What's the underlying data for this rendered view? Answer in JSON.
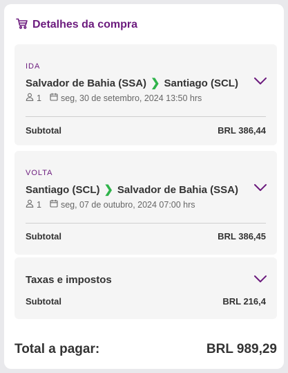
{
  "header": {
    "title": "Detalhes da compra",
    "icon": "shopping-cart-icon"
  },
  "colors": {
    "accent": "#6b1a7d",
    "arrow": "#2fb34a",
    "card_bg": "#f5f5f5"
  },
  "legs": [
    {
      "label": "IDA",
      "origin": "Salvador de Bahia (SSA)",
      "destination": "Santiago (SCL)",
      "passengers": "1",
      "date": "seg, 30 de setembro, 2024 13:50 hrs",
      "subtotal_label": "Subtotal",
      "subtotal_value": "BRL 386,44"
    },
    {
      "label": "VOLTA",
      "origin": "Santiago (SCL)",
      "destination": "Salvador de Bahia (SSA)",
      "passengers": "1",
      "date": "seg, 07 de outubro, 2024 07:00 hrs",
      "subtotal_label": "Subtotal",
      "subtotal_value": "BRL 386,45"
    }
  ],
  "taxes": {
    "label": "Taxas e impostos",
    "subtotal_label": "Subtotal",
    "subtotal_value": "BRL 216,4"
  },
  "total": {
    "label": "Total a pagar:",
    "value": "BRL 989,29"
  }
}
